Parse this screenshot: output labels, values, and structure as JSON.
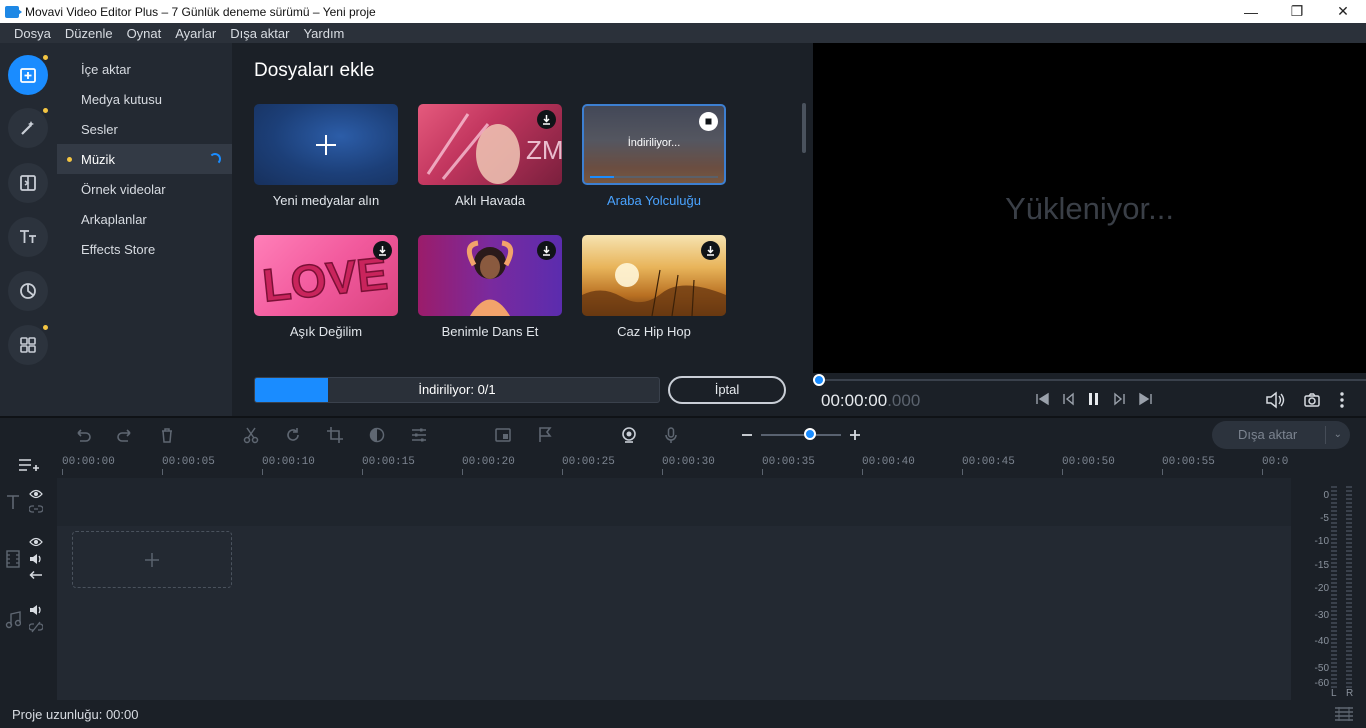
{
  "window": {
    "title": "Movavi Video Editor Plus – 7 Günlük deneme sürümü – Yeni proje",
    "minimize": "—",
    "restore": "❐",
    "close": "✕"
  },
  "menu": [
    "Dosya",
    "Düzenle",
    "Oynat",
    "Ayarlar",
    "Dışa aktar",
    "Yardım"
  ],
  "rail": [
    {
      "icon": "import-icon",
      "active": true,
      "dot": true
    },
    {
      "icon": "magic-wand-icon",
      "active": false,
      "dot": true
    },
    {
      "icon": "transitions-icon",
      "active": false,
      "dot": false
    },
    {
      "icon": "titles-icon",
      "active": false,
      "dot": false
    },
    {
      "icon": "stickers-icon",
      "active": false,
      "dot": false
    },
    {
      "icon": "more-tools-icon",
      "active": false,
      "dot": true
    }
  ],
  "categories": [
    "İçe aktar",
    "Medya kutusu",
    "Sesler",
    "Müzik",
    "Örnek videolar",
    "Arkaplanlar",
    "Effects Store"
  ],
  "selected_category": "Müzik",
  "content": {
    "heading": "Dosyaları ekle",
    "tiles": [
      {
        "caption": "Yeni medyalar alın",
        "kind": "add"
      },
      {
        "caption": "Aklı Havada",
        "kind": "download"
      },
      {
        "caption": "Araba Yolculuğu",
        "kind": "downloading",
        "overlay": "İndiriliyor..."
      },
      {
        "caption": "Aşık Değilim",
        "kind": "download"
      },
      {
        "caption": "Benimle Dans Et",
        "kind": "download"
      },
      {
        "caption": "Caz Hip Hop",
        "kind": "download"
      }
    ],
    "progress_text": "İndiriliyor: 0/1",
    "progress_fraction": 0.18,
    "cancel_label": "İptal"
  },
  "preview": {
    "loading": "Yükleniyor...",
    "time_main": "00:00:00",
    "time_ms": ".000"
  },
  "toolbar": {
    "export_label": "Dışa aktar"
  },
  "ruler_ticks": [
    "00:00:00",
    "00:00:05",
    "00:00:10",
    "00:00:15",
    "00:00:20",
    "00:00:25",
    "00:00:30",
    "00:00:35",
    "00:00:40",
    "00:00:45",
    "00:00:50",
    "00:00:55",
    "00:0"
  ],
  "meter": {
    "scale": [
      "0",
      "-5",
      "-10",
      "-15",
      "-20",
      "-30",
      "-40",
      "-50",
      "-60"
    ],
    "left": "L",
    "right": "R"
  },
  "status": {
    "project_length": "Proje uzunluğu: 00:00"
  },
  "colors": {
    "accent": "#1a8cff",
    "highlight_dot": "#f4c542",
    "selected_caption": "#4aa3ff"
  }
}
